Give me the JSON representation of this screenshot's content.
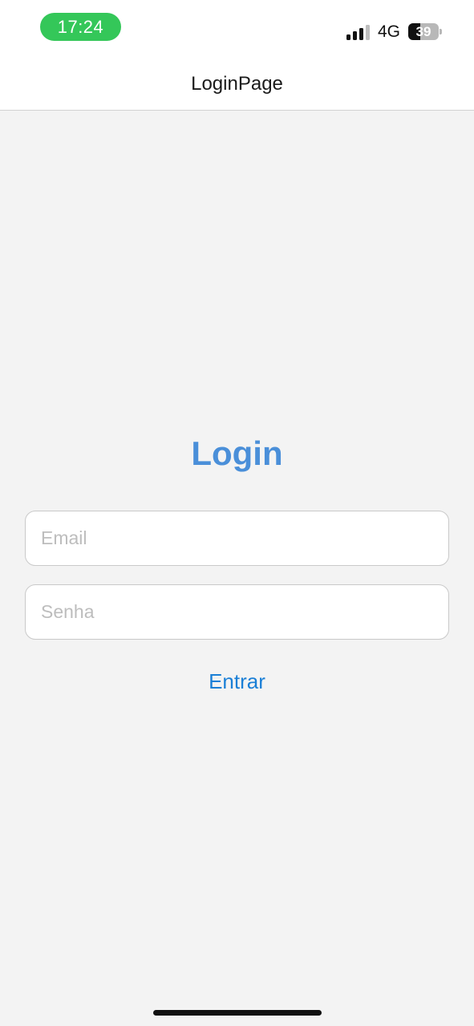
{
  "status_bar": {
    "time": "17:24",
    "network": "4G",
    "battery_level": "39",
    "battery_fraction": 0.39,
    "time_pill_color": "#34c759",
    "signal_bars_active": 3,
    "signal_bars_total": 4,
    "icons": [
      "signal-icon",
      "battery-icon"
    ]
  },
  "nav": {
    "title": "LoginPage"
  },
  "login": {
    "heading": "Login",
    "email_placeholder": "Email",
    "email_value": "",
    "password_placeholder": "Senha",
    "password_value": "",
    "submit_label": "Entrar"
  },
  "colors": {
    "heading": "#4a8fd9",
    "button": "#1a7fd6",
    "background": "#f3f3f3"
  }
}
